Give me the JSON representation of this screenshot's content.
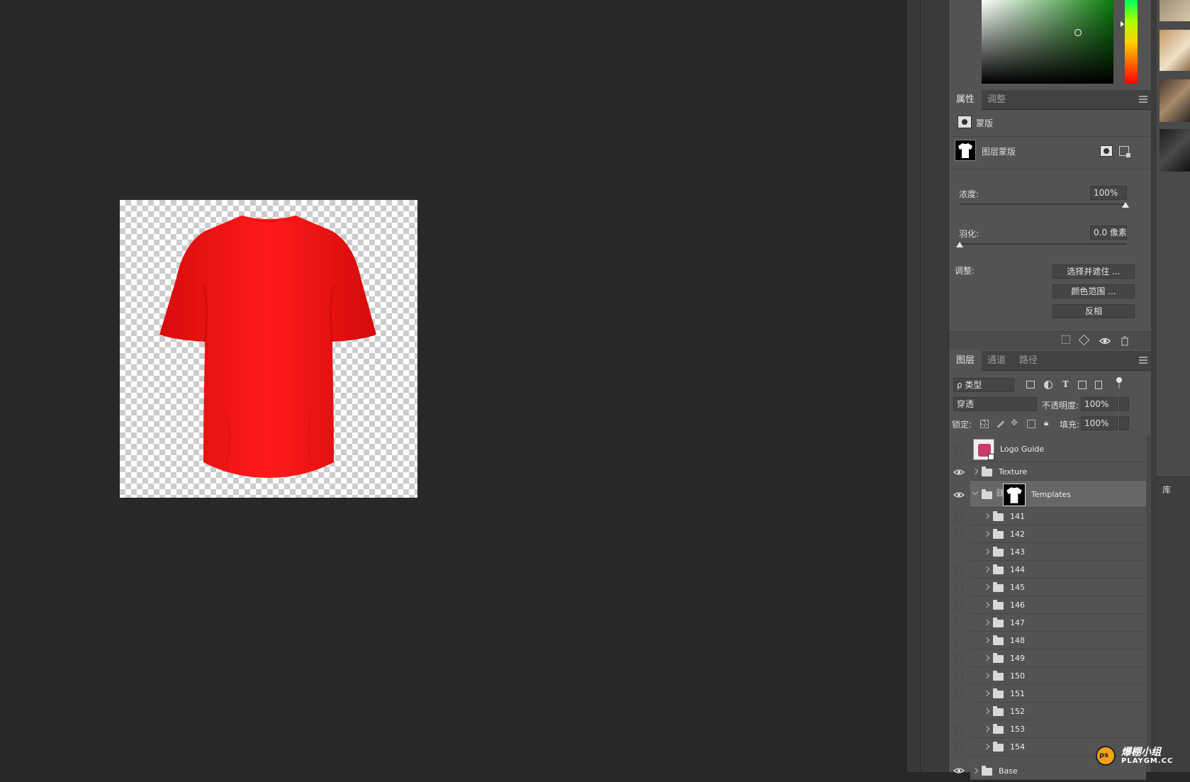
{
  "colors": {
    "canvas_bg": "#282828",
    "panel_bg": "#535353",
    "shirt_red": "#ff1212",
    "selected_row": "#676767"
  },
  "properties_panel": {
    "tabs": [
      "属性",
      "调整"
    ],
    "active_tab": "属性",
    "section_label": "蒙版",
    "mask_label": "图层蒙版",
    "density_label": "浓度:",
    "density_value": "100%",
    "density_level": 1.0,
    "feather_label": "羽化:",
    "feather_value": "0.0 像素",
    "feather_level": 0.0,
    "adjust_label": "调整:",
    "buttons": [
      "选择并遮住 ...",
      "颜色范围 ...",
      "反相"
    ]
  },
  "layers_panel": {
    "tabs": [
      "图层",
      "通道",
      "路径"
    ],
    "active_tab": "图层",
    "filter_label": "ρ 类型",
    "blend_mode": "穿透",
    "opacity_label": "不透明度:",
    "opacity_value": "100%",
    "lock_label": "锁定:",
    "fill_label": "填充:",
    "fill_value": "100%",
    "layers": [
      {
        "name": "Logo Guide",
        "visible": false,
        "kind": "smart-object"
      },
      {
        "name": "Texture",
        "visible": true,
        "kind": "group"
      },
      {
        "name": "Templates",
        "visible": true,
        "kind": "group-with-mask",
        "selected": true
      },
      {
        "name": "141",
        "visible": false,
        "kind": "group"
      },
      {
        "name": "142",
        "visible": false,
        "kind": "group"
      },
      {
        "name": "143",
        "visible": false,
        "kind": "group"
      },
      {
        "name": "144",
        "visible": false,
        "kind": "group"
      },
      {
        "name": "145",
        "visible": false,
        "kind": "group"
      },
      {
        "name": "146",
        "visible": false,
        "kind": "group"
      },
      {
        "name": "147",
        "visible": false,
        "kind": "group"
      },
      {
        "name": "148",
        "visible": false,
        "kind": "group"
      },
      {
        "name": "149",
        "visible": false,
        "kind": "group"
      },
      {
        "name": "150",
        "visible": false,
        "kind": "group"
      },
      {
        "name": "151",
        "visible": false,
        "kind": "group"
      },
      {
        "name": "152",
        "visible": false,
        "kind": "group"
      },
      {
        "name": "153",
        "visible": false,
        "kind": "group"
      },
      {
        "name": "154",
        "visible": false,
        "kind": "group"
      },
      {
        "name": "Base",
        "visible": true,
        "kind": "group"
      }
    ]
  },
  "libraries_tab": "库",
  "watermark": {
    "brand": "爆棚小组",
    "domain": "PLAYGM.CC",
    "badge": "ps"
  }
}
